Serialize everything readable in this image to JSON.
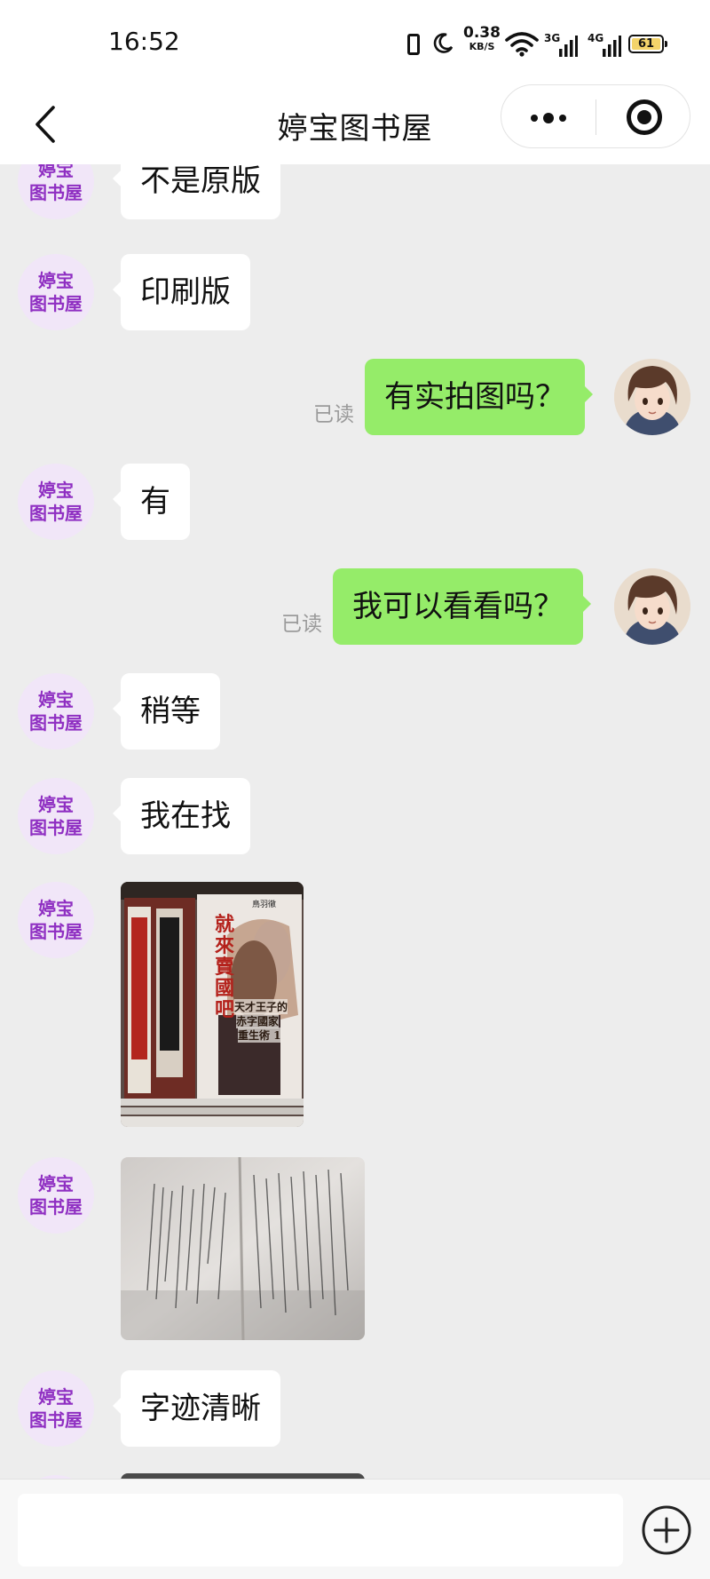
{
  "status_bar": {
    "time": "16:52",
    "net_speed_value": "0.38",
    "net_speed_unit": "KB/S",
    "signal_1_label": "3G",
    "signal_2_label": "4G",
    "battery_level": "61",
    "battery_color": "#f3d36a"
  },
  "nav": {
    "title": "婷宝图书屋"
  },
  "shop_avatar": {
    "line1": "婷宝",
    "line2": "图书屋",
    "color": "#8f2fc2"
  },
  "messages": [
    {
      "from": "shop",
      "type": "text",
      "text": "不是原版"
    },
    {
      "from": "shop",
      "type": "text",
      "text": "印刷版"
    },
    {
      "from": "me",
      "type": "text",
      "text": "有实拍图吗？",
      "status": "已读"
    },
    {
      "from": "shop",
      "type": "text",
      "text": "有"
    },
    {
      "from": "me",
      "type": "text",
      "text": "我可以看看吗？",
      "status": "已读"
    },
    {
      "from": "shop",
      "type": "text",
      "text": "稍等"
    },
    {
      "from": "shop",
      "type": "text",
      "text": "我在找"
    },
    {
      "from": "shop",
      "type": "image",
      "image_name": "book-cover-photo",
      "cover_text": {
        "title": "就來賣國吧",
        "subtitle_1": "天才王子的",
        "subtitle_2": "赤字國家",
        "subtitle_3": "重生術 1",
        "author": "鳥羽徹"
      }
    },
    {
      "from": "shop",
      "type": "image",
      "image_name": "book-page-photo"
    },
    {
      "from": "shop",
      "type": "text",
      "text": "字迹清晰"
    }
  ],
  "input": {
    "placeholder": ""
  },
  "colors": {
    "outgoing_bubble": "#95ec69",
    "incoming_bubble": "#ffffff",
    "background": "#ededed"
  }
}
